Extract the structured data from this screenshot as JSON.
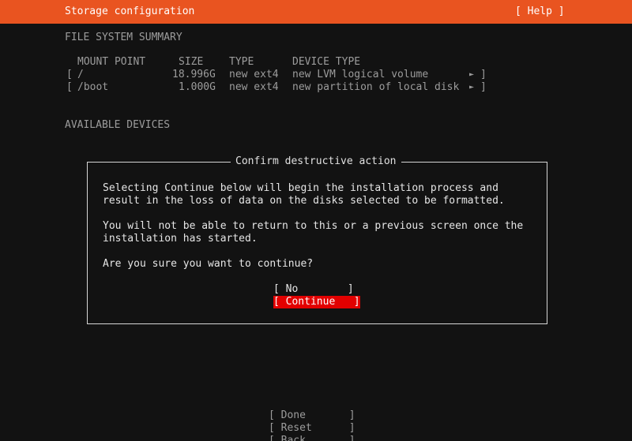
{
  "header": {
    "title": "Storage configuration",
    "help": "[ Help ]"
  },
  "summary": {
    "heading": "FILE SYSTEM SUMMARY",
    "columns": {
      "mount": "MOUNT POINT",
      "size": "SIZE",
      "type": "TYPE",
      "device_type": "DEVICE TYPE"
    },
    "rows": [
      {
        "open": "[",
        "mount": "/",
        "size": "18.996G",
        "type": "new ext4",
        "device_type": "new LVM logical volume",
        "arrow": "►",
        "close": "]"
      },
      {
        "open": "[",
        "mount": "/boot",
        "size": "1.000G",
        "type": "new ext4",
        "device_type": "new partition of local disk",
        "arrow": "►",
        "close": "]"
      }
    ]
  },
  "available": {
    "heading": "AVAILABLE DEVICES"
  },
  "dialog": {
    "title": "Confirm destructive action",
    "line1": "Selecting Continue below will begin the installation process and",
    "line2": "result in the loss of data on the disks selected to be formatted.",
    "line3": "You will not be able to return to this or a previous screen once the",
    "line4": "installation has started.",
    "question": "Are you sure you want to continue?",
    "no_button": "[ No        ]",
    "continue_button": "[ Continue   ]"
  },
  "footer": {
    "done": "[ Done       ]",
    "reset": "[ Reset      ]",
    "back": "[ Back       ]"
  }
}
